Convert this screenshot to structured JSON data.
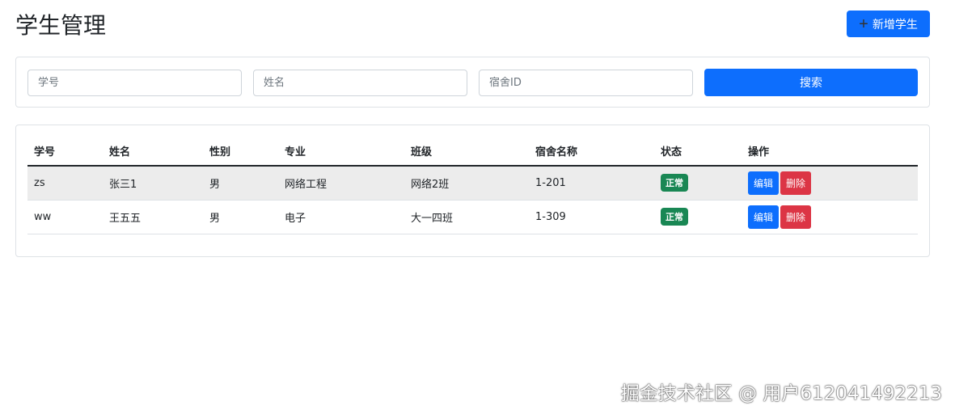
{
  "title": "学生管理",
  "add_button": "新增学生",
  "search": {
    "student_id_placeholder": "学号",
    "name_placeholder": "姓名",
    "dorm_placeholder": "宿舍ID",
    "search_button": "搜索"
  },
  "table": {
    "headers": [
      "学号",
      "姓名",
      "性别",
      "专业",
      "班级",
      "宿舍名称",
      "状态",
      "操作"
    ],
    "rows": [
      {
        "id": "zs",
        "name": "张三1",
        "gender": "男",
        "major": "网络工程",
        "class": "网络2班",
        "dorm": "1-201",
        "status": "正常"
      },
      {
        "id": "ww",
        "name": "王五五",
        "gender": "男",
        "major": "电子",
        "class": "大一四班",
        "dorm": "1-309",
        "status": "正常"
      }
    ],
    "edit_label": "编辑",
    "delete_label": "删除"
  },
  "watermark": "掘金技术社区 @ 用户612041492213"
}
